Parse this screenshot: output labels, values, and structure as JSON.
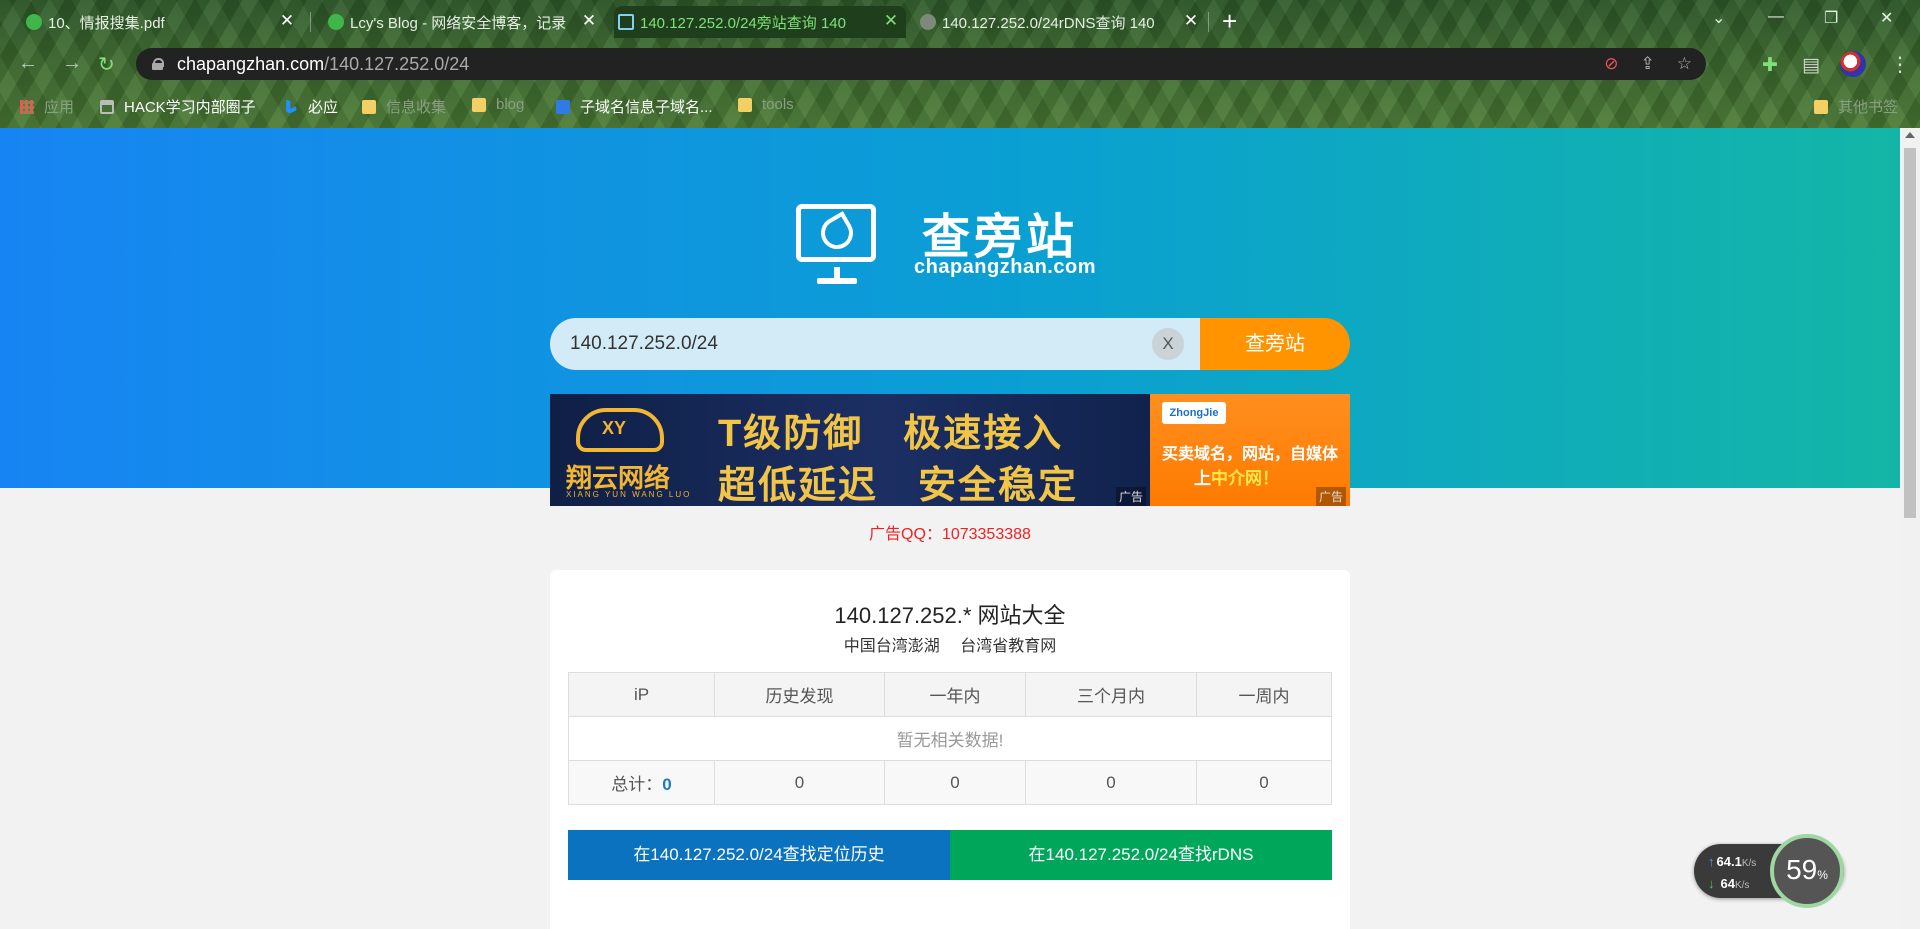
{
  "browser": {
    "tabs": [
      {
        "title": "10、情报搜集.pdf"
      },
      {
        "title": "Lcy's Blog - 网络安全博客，记录"
      },
      {
        "title": "140.127.252.0/24旁站查询 140"
      },
      {
        "title": "140.127.252.0/24rDNS查询 140"
      }
    ],
    "url_host": "chapangzhan.com",
    "url_path": "/140.127.252.0/24",
    "bookmarks": [
      {
        "label": "应用"
      },
      {
        "label": "HACK学习内部圈子"
      },
      {
        "label": "必应"
      },
      {
        "label": "信息收集"
      },
      {
        "label": "blog"
      },
      {
        "label": "子域名信息子域名..."
      },
      {
        "label": "tools"
      },
      {
        "label": "其他书签"
      }
    ]
  },
  "site": {
    "logo_title": "查旁站",
    "logo_sub": "chapangzhan.com",
    "search_value": "140.127.252.0/24",
    "clear_label": "X",
    "search_button": "查旁站",
    "ad_left": {
      "brand": "翔云网络",
      "brand_en": "XIANG YUN WANG LUO",
      "line1": "T级防御　极速接入",
      "line2": "超低延迟　安全稳定",
      "tag": "广告"
    },
    "ad_right": {
      "logo": "ZhongJie",
      "line1": "买卖域名，网站，自媒体",
      "line2_pre": "上",
      "line2_hl": "中介网！",
      "tag": "广告"
    },
    "ad_qq": "广告QQ：1073353388"
  },
  "result": {
    "title": "140.127.252.* 网站大全",
    "location": "中国台湾澎湖",
    "network": "台湾省教育网",
    "columns": [
      "iP",
      "历史发现",
      "一年内",
      "三个月内",
      "一周内"
    ],
    "empty_text": "暂无相关数据!",
    "total_label": "总计：",
    "total_value": "0",
    "counts": [
      "0",
      "0",
      "0",
      "0"
    ],
    "btn_history": "在140.127.252.0/24查找定位历史",
    "btn_rdns": "在140.127.252.0/24查找rDNS"
  },
  "netmon": {
    "up": "64.1",
    "down": "64",
    "unit": "K/s",
    "percent": "59",
    "percent_sign": "%"
  }
}
